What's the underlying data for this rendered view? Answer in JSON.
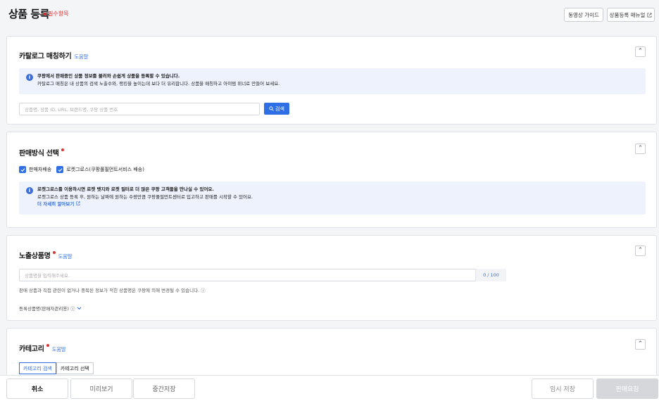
{
  "header": {
    "title": "상품 등록",
    "required_note": "필수항목",
    "video_guide": "동영상 가이드",
    "manual": "상품등록 매뉴얼",
    "manual_icon": "external-link-icon"
  },
  "catalog": {
    "title": "카탈로그 매칭하기",
    "help": "도움말",
    "info_line1": "쿠팡에서 판매중인 상품 정보를 불러와 손쉽게 상품을 등록할 수 있습니다.",
    "info_line2": "카탈로그 매칭은 내 상품의 검색 노출수와, 랭킹을 높이는데 보다 더 유리합니다. 상품을 매칭하고 아이템 위너로 만들어 보세요.",
    "search_placeholder": "상품명, 상품 ID, URL, 브랜드명, 쿠팡 상품 번호",
    "search_button": "검색"
  },
  "sales_method": {
    "title": "판매방식 선택",
    "option1": "판매자배송",
    "option2": "로켓그로스(쿠팡풀필먼트서비스 배송)",
    "info_line1": "로켓그로스를 이용하시면 로켓 뱃지와 로켓 필터로 더 많은 쿠팡 고객들을 만나실 수 있어요.",
    "info_line2": "로켓그로스 상품 등록 후, 원하는 날짜에 원하는 수량만큼 쿠팡풀필먼트센터로 입고하고 판매를 시작할 수 있어요.",
    "info_link": "더 자세히 알아보기"
  },
  "product_name": {
    "title": "노출상품명",
    "help": "도움말",
    "placeholder": "상품명을 입력해주세요.",
    "counter": "0 / 100",
    "hint": "판매 상품과 직접 관련이 없거나 중복된 정보가 적힌 상품명은 쿠팡에 의해 변경될 수 있습니다.",
    "registered_label": "등록상품명(판매자관리용)"
  },
  "category": {
    "title": "카테고리",
    "help": "도움말",
    "tab_search": "카테고리 검색",
    "tab_select": "카테고리 선택"
  },
  "footer": {
    "cancel": "취소",
    "preview": "미리보기",
    "temp_save": "중간저장",
    "draft_save": "임시 저장",
    "submit": "판매요청"
  },
  "colors": {
    "accent": "#2f6fe6",
    "required": "#e03030",
    "info_bg": "#eef2fd"
  }
}
